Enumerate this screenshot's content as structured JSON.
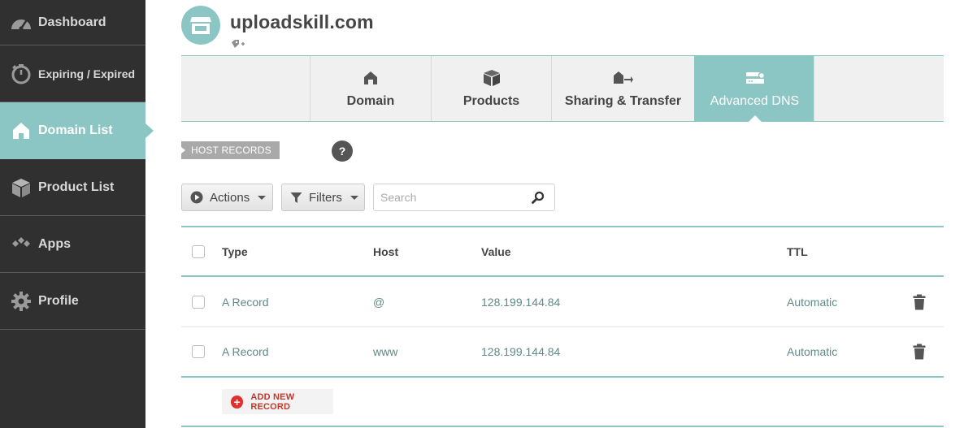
{
  "sidebar": {
    "items": [
      {
        "label": "Dashboard",
        "icon": "dashboard-icon"
      },
      {
        "label": "Expiring / Expired",
        "icon": "timer-icon"
      },
      {
        "label": "Domain List",
        "icon": "home-icon",
        "active": true
      },
      {
        "label": "Product List",
        "icon": "box-icon"
      },
      {
        "label": "Apps",
        "icon": "apps-icon"
      },
      {
        "label": "Profile",
        "icon": "gear-icon"
      }
    ]
  },
  "header": {
    "domain": "uploadskill.com"
  },
  "tabs": [
    {
      "label": "Domain",
      "icon": "home-icon"
    },
    {
      "label": "Products",
      "icon": "box-icon"
    },
    {
      "label": "Sharing & Transfer",
      "icon": "transfer-icon"
    },
    {
      "label": "Advanced DNS",
      "icon": "server-icon",
      "active": true
    }
  ],
  "section": {
    "label": "HOST RECORDS",
    "help": "?"
  },
  "toolbar": {
    "actions_label": "Actions",
    "filters_label": "Filters",
    "search_placeholder": "Search"
  },
  "table": {
    "headers": {
      "type": "Type",
      "host": "Host",
      "value": "Value",
      "ttl": "TTL"
    },
    "rows": [
      {
        "type": "A Record",
        "host": "@",
        "value": "128.199.144.84",
        "ttl": "Automatic"
      },
      {
        "type": "A Record",
        "host": "www",
        "value": "128.199.144.84",
        "ttl": "Automatic"
      }
    ]
  },
  "add_record_label": "ADD NEW RECORD",
  "colors": {
    "accent": "#8bc6c4",
    "sidebar_bg": "#303030",
    "link_text": "#5f8a87",
    "add_red": "#e0302e"
  }
}
